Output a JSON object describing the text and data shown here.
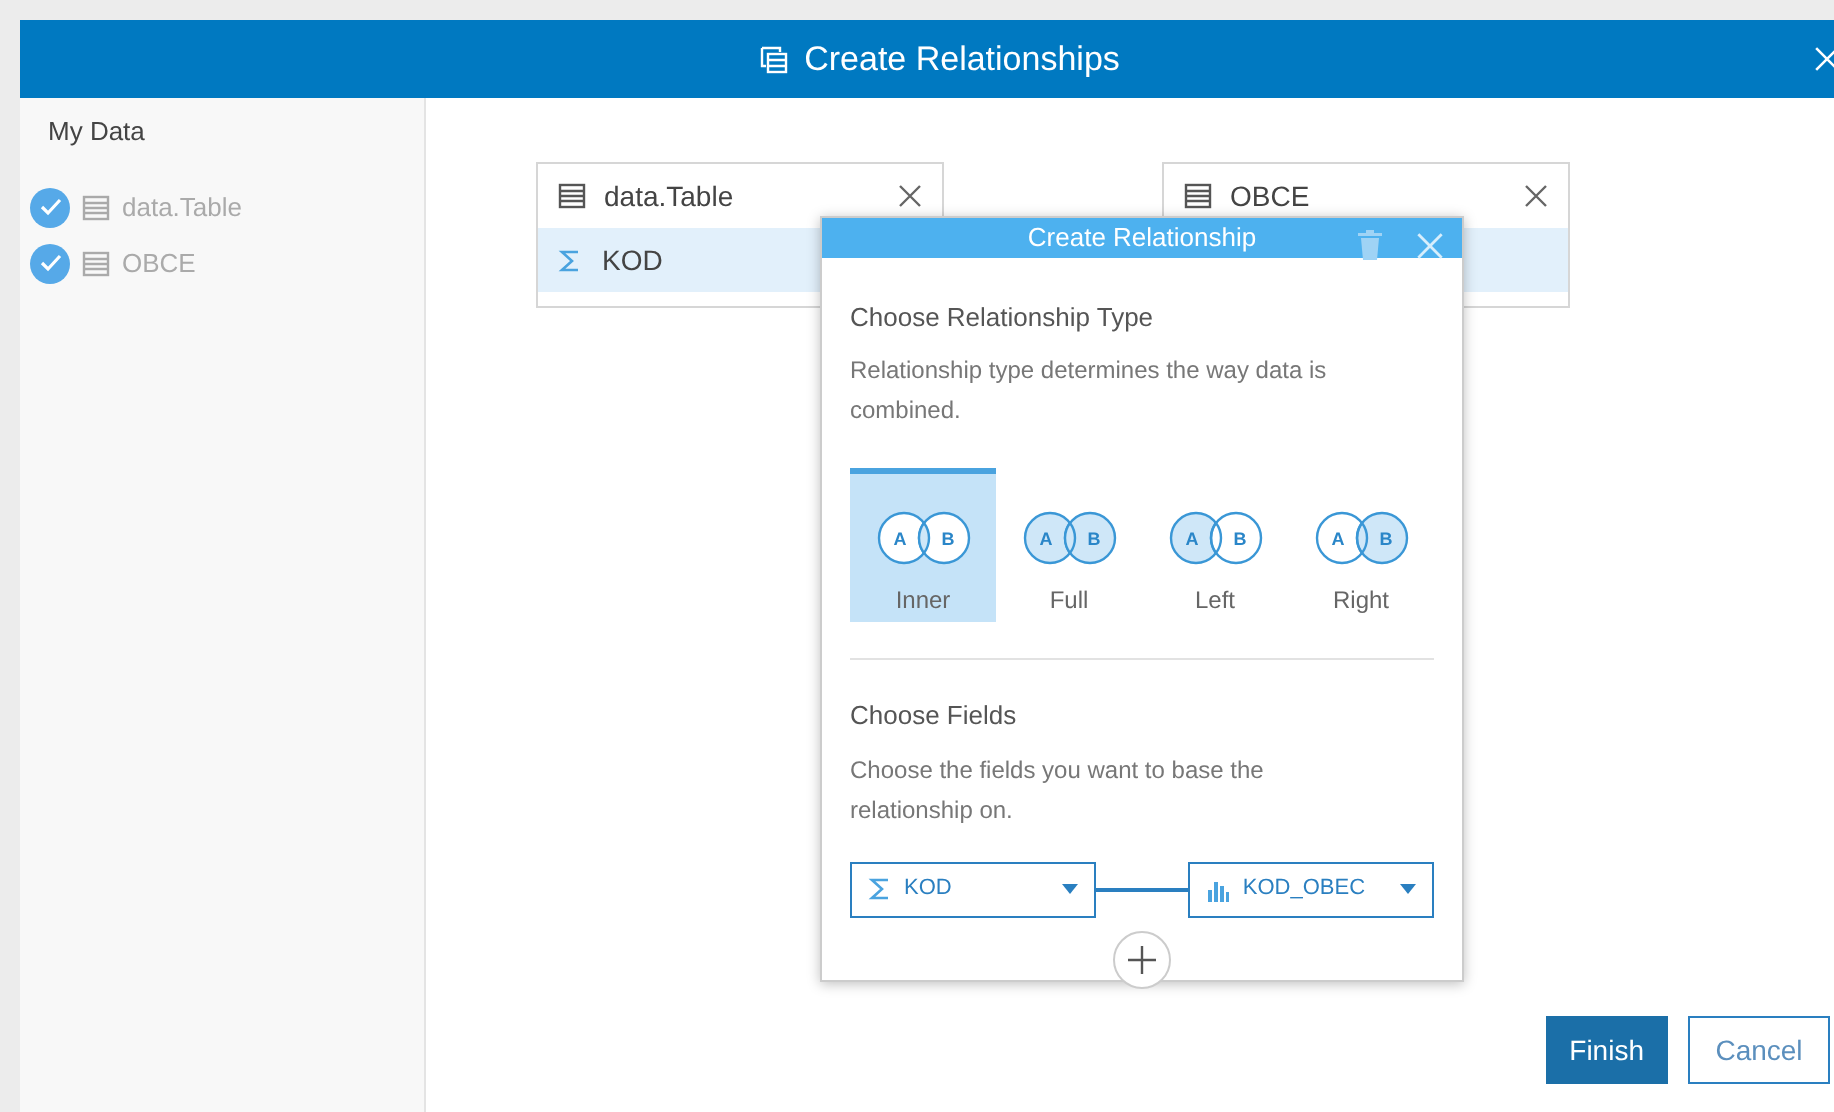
{
  "window": {
    "title": "Create Relationships"
  },
  "sidebar": {
    "heading": "My Data",
    "items": [
      {
        "label": "data.Table",
        "checked": true
      },
      {
        "label": "OBCE",
        "checked": true
      }
    ]
  },
  "cards": [
    {
      "title": "data.Table",
      "fields": [
        {
          "name": "KOD",
          "kind": "number"
        }
      ]
    },
    {
      "title": "OBCE"
    }
  ],
  "popup": {
    "title": "Create Relationship",
    "type_heading": "Choose Relationship Type",
    "type_description": "Relationship type determines the way data is combined.",
    "types": [
      {
        "label": "Inner",
        "kind": "inner",
        "selected": true,
        "letters": [
          "A",
          "B"
        ]
      },
      {
        "label": "Full",
        "kind": "full",
        "selected": false,
        "letters": [
          "A",
          "B"
        ]
      },
      {
        "label": "Left",
        "kind": "left",
        "selected": false,
        "letters": [
          "A",
          "B"
        ]
      },
      {
        "label": "Right",
        "kind": "right",
        "selected": false,
        "letters": [
          "A",
          "B"
        ]
      }
    ],
    "fields_heading": "Choose Fields",
    "fields_description": "Choose the fields you want to base the relationship on.",
    "field_pair": [
      {
        "value": "KOD",
        "kind": "number"
      },
      {
        "value": "KOD_OBEC",
        "kind": "string"
      }
    ]
  },
  "buttons": [
    {
      "label": "Finish",
      "kind": "primary"
    },
    {
      "label": "Cancel",
      "kind": "secondary"
    }
  ]
}
